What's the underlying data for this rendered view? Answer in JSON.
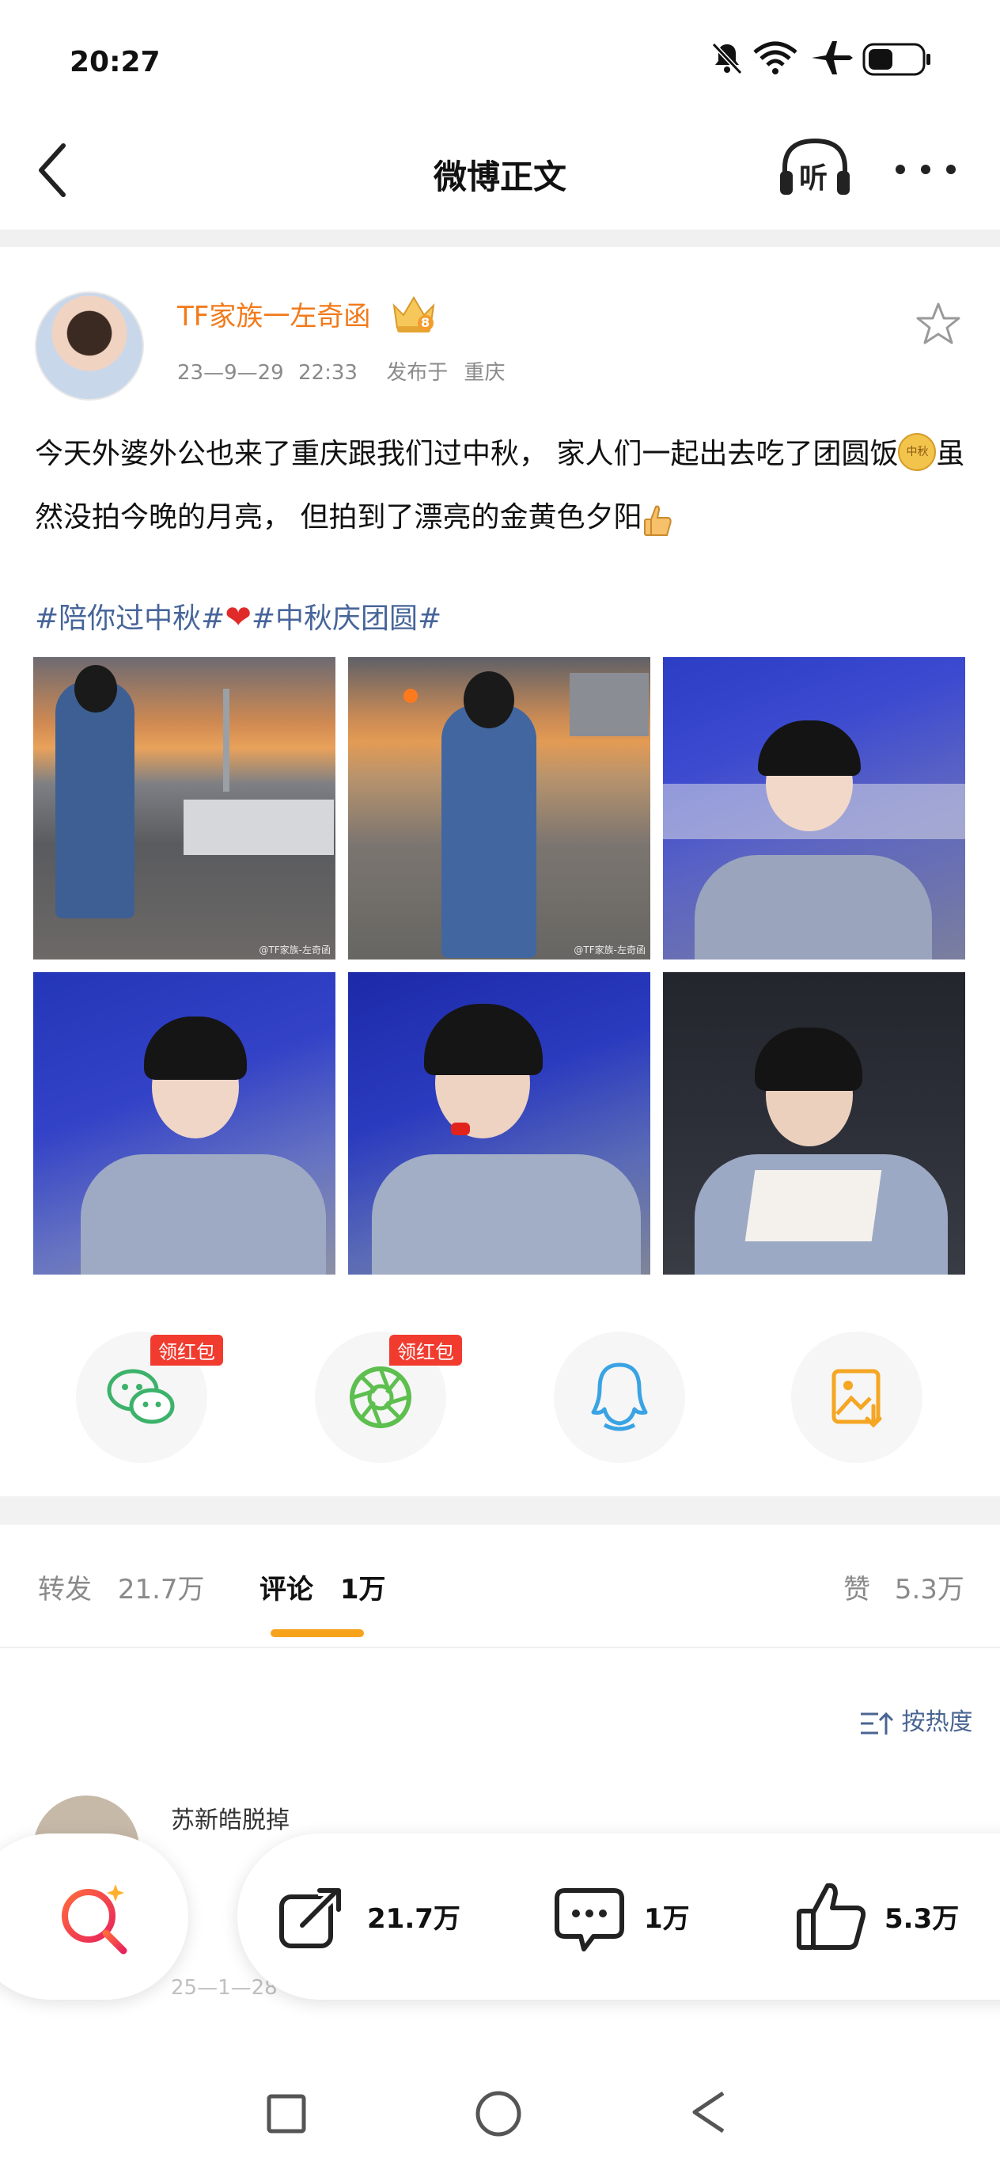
{
  "status_bar": {
    "time": "20:27",
    "icons": [
      "mute-bell-icon",
      "wifi-icon",
      "airplane-icon",
      "battery-icon"
    ]
  },
  "nav": {
    "title": "微博正文",
    "back_icon": "back-chevron-icon",
    "listen_label": "听",
    "more_icon": "more-dots-icon"
  },
  "post": {
    "author": "TF家族一左奇函",
    "badge_level": "8",
    "date": "23—9—29",
    "time": "22:33",
    "location_label": "发布于",
    "location": "重庆",
    "text_1": "今天外婆外公也来了重庆跟我们过中秋， 家人们一起出去吃了团圆饭",
    "text_emoji_1": "中秋",
    "text_2": "虽然没拍今晚的月亮， 但拍到了漂亮的金黄色夕阳",
    "hashtag_1": "#陪你过中秋#",
    "hashtag_2": "#中秋庆团圆#",
    "watermark": "@TF家族-左奇函",
    "photos": [
      "sunset-river-back-1",
      "sunset-river-back-2",
      "restaurant-portrait-1",
      "restaurant-portrait-2",
      "restaurant-portrait-3",
      "eating-portrait"
    ]
  },
  "share": {
    "redpack_label": "领红包",
    "targets": [
      "wechat-icon",
      "moments-icon",
      "qq-icon",
      "save-image-icon"
    ]
  },
  "tabs": {
    "repost_label": "转发",
    "repost_count": "21.7万",
    "comment_label": "评论",
    "comment_count": "1万",
    "like_label": "赞",
    "like_count": "5.3万"
  },
  "sort_label": "按热度",
  "comment": {
    "username": "苏新皓脱掉",
    "date": "25—1—28"
  },
  "bottom_bar": {
    "repost_count": "21.7万",
    "comment_count": "1万",
    "like_count": "5.3万"
  },
  "colors": {
    "username": "#f27a1a",
    "hashtag": "#47659a",
    "accent": "#f7a21b",
    "redpack": "#f23b2f"
  }
}
